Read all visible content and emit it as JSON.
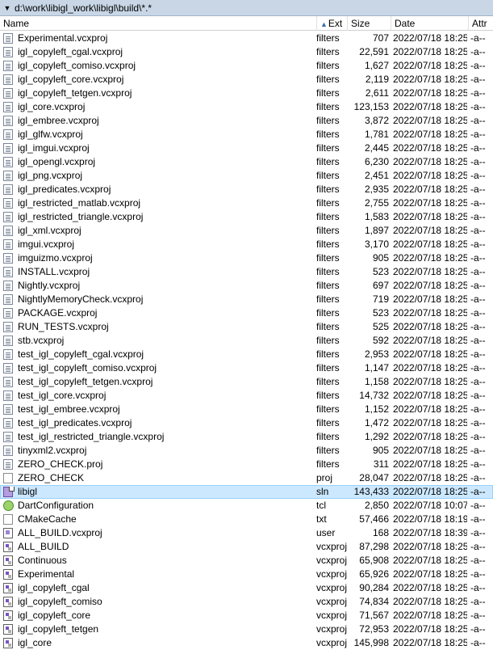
{
  "path": "d:\\work\\libigl_work\\libigl\\build\\*.*",
  "columns": {
    "name": "Name",
    "ext": "Ext",
    "size": "Size",
    "date": "Date",
    "attr": "Attr"
  },
  "sort_indicator": "up-arrow",
  "selected_row": "libigl",
  "rows": [
    {
      "name": "Experimental.vcxproj",
      "ext": "filters",
      "size": "707",
      "date": "2022/07/18 18:25",
      "attr": "-a--",
      "icon": "file-icon"
    },
    {
      "name": "igl_copyleft_cgal.vcxproj",
      "ext": "filters",
      "size": "22,591",
      "date": "2022/07/18 18:25",
      "attr": "-a--",
      "icon": "file-icon"
    },
    {
      "name": "igl_copyleft_comiso.vcxproj",
      "ext": "filters",
      "size": "1,627",
      "date": "2022/07/18 18:25",
      "attr": "-a--",
      "icon": "file-icon"
    },
    {
      "name": "igl_copyleft_core.vcxproj",
      "ext": "filters",
      "size": "2,119",
      "date": "2022/07/18 18:25",
      "attr": "-a--",
      "icon": "file-icon"
    },
    {
      "name": "igl_copyleft_tetgen.vcxproj",
      "ext": "filters",
      "size": "2,611",
      "date": "2022/07/18 18:25",
      "attr": "-a--",
      "icon": "file-icon"
    },
    {
      "name": "igl_core.vcxproj",
      "ext": "filters",
      "size": "123,153",
      "date": "2022/07/18 18:25",
      "attr": "-a--",
      "icon": "file-icon"
    },
    {
      "name": "igl_embree.vcxproj",
      "ext": "filters",
      "size": "3,872",
      "date": "2022/07/18 18:25",
      "attr": "-a--",
      "icon": "file-icon"
    },
    {
      "name": "igl_glfw.vcxproj",
      "ext": "filters",
      "size": "1,781",
      "date": "2022/07/18 18:25",
      "attr": "-a--",
      "icon": "file-icon"
    },
    {
      "name": "igl_imgui.vcxproj",
      "ext": "filters",
      "size": "2,445",
      "date": "2022/07/18 18:25",
      "attr": "-a--",
      "icon": "file-icon"
    },
    {
      "name": "igl_opengl.vcxproj",
      "ext": "filters",
      "size": "6,230",
      "date": "2022/07/18 18:25",
      "attr": "-a--",
      "icon": "file-icon"
    },
    {
      "name": "igl_png.vcxproj",
      "ext": "filters",
      "size": "2,451",
      "date": "2022/07/18 18:25",
      "attr": "-a--",
      "icon": "file-icon"
    },
    {
      "name": "igl_predicates.vcxproj",
      "ext": "filters",
      "size": "2,935",
      "date": "2022/07/18 18:25",
      "attr": "-a--",
      "icon": "file-icon"
    },
    {
      "name": "igl_restricted_matlab.vcxproj",
      "ext": "filters",
      "size": "2,755",
      "date": "2022/07/18 18:25",
      "attr": "-a--",
      "icon": "file-icon"
    },
    {
      "name": "igl_restricted_triangle.vcxproj",
      "ext": "filters",
      "size": "1,583",
      "date": "2022/07/18 18:25",
      "attr": "-a--",
      "icon": "file-icon"
    },
    {
      "name": "igl_xml.vcxproj",
      "ext": "filters",
      "size": "1,897",
      "date": "2022/07/18 18:25",
      "attr": "-a--",
      "icon": "file-icon"
    },
    {
      "name": "imgui.vcxproj",
      "ext": "filters",
      "size": "3,170",
      "date": "2022/07/18 18:25",
      "attr": "-a--",
      "icon": "file-icon"
    },
    {
      "name": "imguizmo.vcxproj",
      "ext": "filters",
      "size": "905",
      "date": "2022/07/18 18:25",
      "attr": "-a--",
      "icon": "file-icon"
    },
    {
      "name": "INSTALL.vcxproj",
      "ext": "filters",
      "size": "523",
      "date": "2022/07/18 18:25",
      "attr": "-a--",
      "icon": "file-icon"
    },
    {
      "name": "Nightly.vcxproj",
      "ext": "filters",
      "size": "697",
      "date": "2022/07/18 18:25",
      "attr": "-a--",
      "icon": "file-icon"
    },
    {
      "name": "NightlyMemoryCheck.vcxproj",
      "ext": "filters",
      "size": "719",
      "date": "2022/07/18 18:25",
      "attr": "-a--",
      "icon": "file-icon"
    },
    {
      "name": "PACKAGE.vcxproj",
      "ext": "filters",
      "size": "523",
      "date": "2022/07/18 18:25",
      "attr": "-a--",
      "icon": "file-icon"
    },
    {
      "name": "RUN_TESTS.vcxproj",
      "ext": "filters",
      "size": "525",
      "date": "2022/07/18 18:25",
      "attr": "-a--",
      "icon": "file-icon"
    },
    {
      "name": "stb.vcxproj",
      "ext": "filters",
      "size": "592",
      "date": "2022/07/18 18:25",
      "attr": "-a--",
      "icon": "file-icon"
    },
    {
      "name": "test_igl_copyleft_cgal.vcxproj",
      "ext": "filters",
      "size": "2,953",
      "date": "2022/07/18 18:25",
      "attr": "-a--",
      "icon": "file-icon"
    },
    {
      "name": "test_igl_copyleft_comiso.vcxproj",
      "ext": "filters",
      "size": "1,147",
      "date": "2022/07/18 18:25",
      "attr": "-a--",
      "icon": "file-icon"
    },
    {
      "name": "test_igl_copyleft_tetgen.vcxproj",
      "ext": "filters",
      "size": "1,158",
      "date": "2022/07/18 18:25",
      "attr": "-a--",
      "icon": "file-icon"
    },
    {
      "name": "test_igl_core.vcxproj",
      "ext": "filters",
      "size": "14,732",
      "date": "2022/07/18 18:25",
      "attr": "-a--",
      "icon": "file-icon"
    },
    {
      "name": "test_igl_embree.vcxproj",
      "ext": "filters",
      "size": "1,152",
      "date": "2022/07/18 18:25",
      "attr": "-a--",
      "icon": "file-icon"
    },
    {
      "name": "test_igl_predicates.vcxproj",
      "ext": "filters",
      "size": "1,472",
      "date": "2022/07/18 18:25",
      "attr": "-a--",
      "icon": "file-icon"
    },
    {
      "name": "test_igl_restricted_triangle.vcxproj",
      "ext": "filters",
      "size": "1,292",
      "date": "2022/07/18 18:25",
      "attr": "-a--",
      "icon": "file-icon"
    },
    {
      "name": "tinyxml2.vcxproj",
      "ext": "filters",
      "size": "905",
      "date": "2022/07/18 18:25",
      "attr": "-a--",
      "icon": "file-icon"
    },
    {
      "name": "ZERO_CHECK.proj",
      "ext": "filters",
      "size": "311",
      "date": "2022/07/18 18:25",
      "attr": "-a--",
      "icon": "file-icon"
    },
    {
      "name": "ZERO_CHECK",
      "ext": "proj",
      "size": "28,047",
      "date": "2022/07/18 18:25",
      "attr": "-a--",
      "icon": "blank-file-icon"
    },
    {
      "name": "libigl",
      "ext": "sln",
      "size": "143,433",
      "date": "2022/07/18 18:25",
      "attr": "-a--",
      "icon": "solution-icon"
    },
    {
      "name": "DartConfiguration",
      "ext": "tcl",
      "size": "2,850",
      "date": "2022/07/18 10:07",
      "attr": "-a--",
      "icon": "tcl-icon"
    },
    {
      "name": "CMakeCache",
      "ext": "txt",
      "size": "57,466",
      "date": "2022/07/18 18:19",
      "attr": "-a--",
      "icon": "blank-file-icon"
    },
    {
      "name": "ALL_BUILD.vcxproj",
      "ext": "user",
      "size": "168",
      "date": "2022/07/18 18:39",
      "attr": "-a--",
      "icon": "user-file-icon"
    },
    {
      "name": "ALL_BUILD",
      "ext": "vcxproj",
      "size": "87,298",
      "date": "2022/07/18 18:25",
      "attr": "-a--",
      "icon": "vcxproj-icon"
    },
    {
      "name": "Continuous",
      "ext": "vcxproj",
      "size": "65,908",
      "date": "2022/07/18 18:25",
      "attr": "-a--",
      "icon": "vcxproj-icon"
    },
    {
      "name": "Experimental",
      "ext": "vcxproj",
      "size": "65,926",
      "date": "2022/07/18 18:25",
      "attr": "-a--",
      "icon": "vcxproj-icon"
    },
    {
      "name": "igl_copyleft_cgal",
      "ext": "vcxproj",
      "size": "90,284",
      "date": "2022/07/18 18:25",
      "attr": "-a--",
      "icon": "vcxproj-icon"
    },
    {
      "name": "igl_copyleft_comiso",
      "ext": "vcxproj",
      "size": "74,834",
      "date": "2022/07/18 18:25",
      "attr": "-a--",
      "icon": "vcxproj-icon"
    },
    {
      "name": "igl_copyleft_core",
      "ext": "vcxproj",
      "size": "71,567",
      "date": "2022/07/18 18:25",
      "attr": "-a--",
      "icon": "vcxproj-icon"
    },
    {
      "name": "igl_copyleft_tetgen",
      "ext": "vcxproj",
      "size": "72,953",
      "date": "2022/07/18 18:25",
      "attr": "-a--",
      "icon": "vcxproj-icon"
    },
    {
      "name": "igl_core",
      "ext": "vcxproj",
      "size": "145,998",
      "date": "2022/07/18 18:25",
      "attr": "-a--",
      "icon": "vcxproj-icon"
    }
  ]
}
